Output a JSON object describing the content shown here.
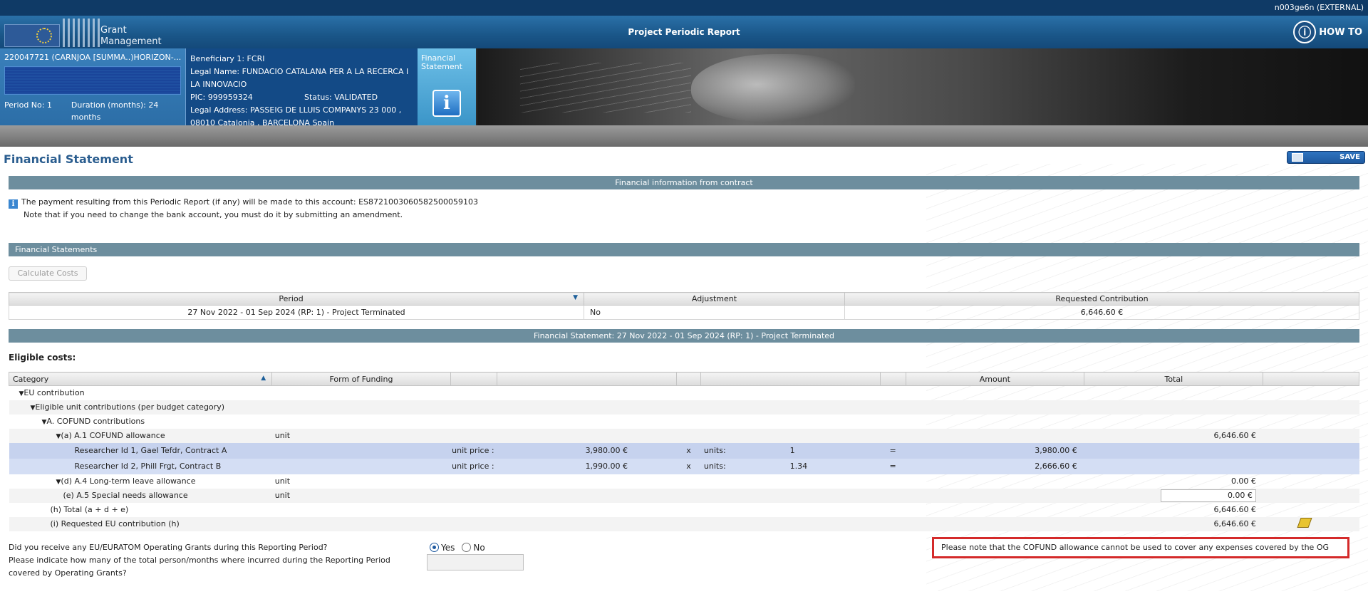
{
  "topbar": {
    "user": "n003ge6n (EXTERNAL)"
  },
  "logo": {
    "line1": "Grant",
    "line2": "Management"
  },
  "banner": {
    "title": "Project Periodic Report",
    "howto": "HOW TO"
  },
  "project": {
    "title": "220047721 (CARNJOA [SUMMA..)HORIZON-...",
    "period": "Period No: 1",
    "duration": "Duration (months): 24 months"
  },
  "beneficiary": {
    "name": "Beneficiary 1: FCRI",
    "legal_name": "Legal Name: FUNDACIO CATALANA PER A LA RECERCA I LA INNOVACIO",
    "pic": "PIC: 999959324",
    "status": "Status: VALIDATED",
    "address": "Legal Address: PASSEIG DE LLUIS COMPANYS 23 000 , 08010 Catalonia , BARCELONA Spain"
  },
  "fs_tab": {
    "label_1": "Financial",
    "label_2": "Statement",
    "icon": "info-icon"
  },
  "page": {
    "title": "Financial Statement",
    "save": "SAVE"
  },
  "contract_section": {
    "header": "Financial information from contract",
    "line1": "The payment resulting from this Periodic Report (if any) will be made to this account: ES8721003060582500059103",
    "line2": "Note that if you need to change the bank account, you must do it by submitting an amendment."
  },
  "statements_section": {
    "header": "Financial Statements",
    "calc_button": "Calculate Costs",
    "columns": [
      "Period",
      "Adjustment",
      "Requested Contribution"
    ],
    "row": {
      "period": "27 Nov 2022 - 01 Sep 2024 (RP: 1) - Project Terminated",
      "adjustment": "No",
      "requested": "6,646.60 €"
    }
  },
  "fs_section": {
    "header": "Financial Statement: 27 Nov 2022 - 01 Sep 2024 (RP: 1) - Project Terminated",
    "eligible_label": "Eligible costs:",
    "columns": {
      "category": "Category",
      "form": "Form of Funding",
      "amount": "Amount",
      "total": "Total"
    },
    "rows": {
      "eu": "EU contribution",
      "eligible_unit": "Eligible unit contributions (per budget category)",
      "a_cofund": "A. COFUND contributions",
      "a1": "(a) A.1 COFUND allowance",
      "a1_form": "unit",
      "a1_total": "6,646.60 €",
      "r1": {
        "name": "Researcher Id 1, Gael Tefdr, Contract A",
        "unit_price_label": "unit price :",
        "unit_price": "3,980.00 €",
        "x": "x",
        "units_label": "units:",
        "units": "1",
        "eq": "=",
        "amount": "3,980.00 €"
      },
      "r2": {
        "name": "Researcher Id 2, Phill Frgt, Contract B",
        "unit_price_label": "unit price :",
        "unit_price": "1,990.00 €",
        "x": "x",
        "units_label": "units:",
        "units": "1.34",
        "eq": "=",
        "amount": "2,666.60 €"
      },
      "d": "(d) A.4 Long-term leave allowance",
      "d_form": "unit",
      "d_total": "0.00 €",
      "e": "(e) A.5 Special needs allowance",
      "e_form": "unit",
      "e_total": "0.00 €",
      "h": "(h) Total (a + d + e)",
      "h_total": "6,646.60 €",
      "i": "(i) Requested EU contribution (h)",
      "i_total": "6,646.60 €"
    }
  },
  "og_question": {
    "q1": "Did you receive any EU/EURATOM Operating Grants during this Reporting Period?",
    "q2a": "Please indicate how many of the total person/months where incurred during the Reporting Period",
    "q2b": "covered by Operating Grants?",
    "yes": "Yes",
    "no": "No",
    "selected": "Yes",
    "months_value": "",
    "warning": "Please note that the COFUND allowance cannot be used to cover any expenses covered by the OG"
  },
  "colors": {
    "section_bar": "#6d8e9e",
    "title_blue": "#2a5d8f",
    "highlight_row": "#c6d2ee",
    "warning_border": "#d42a2a"
  }
}
